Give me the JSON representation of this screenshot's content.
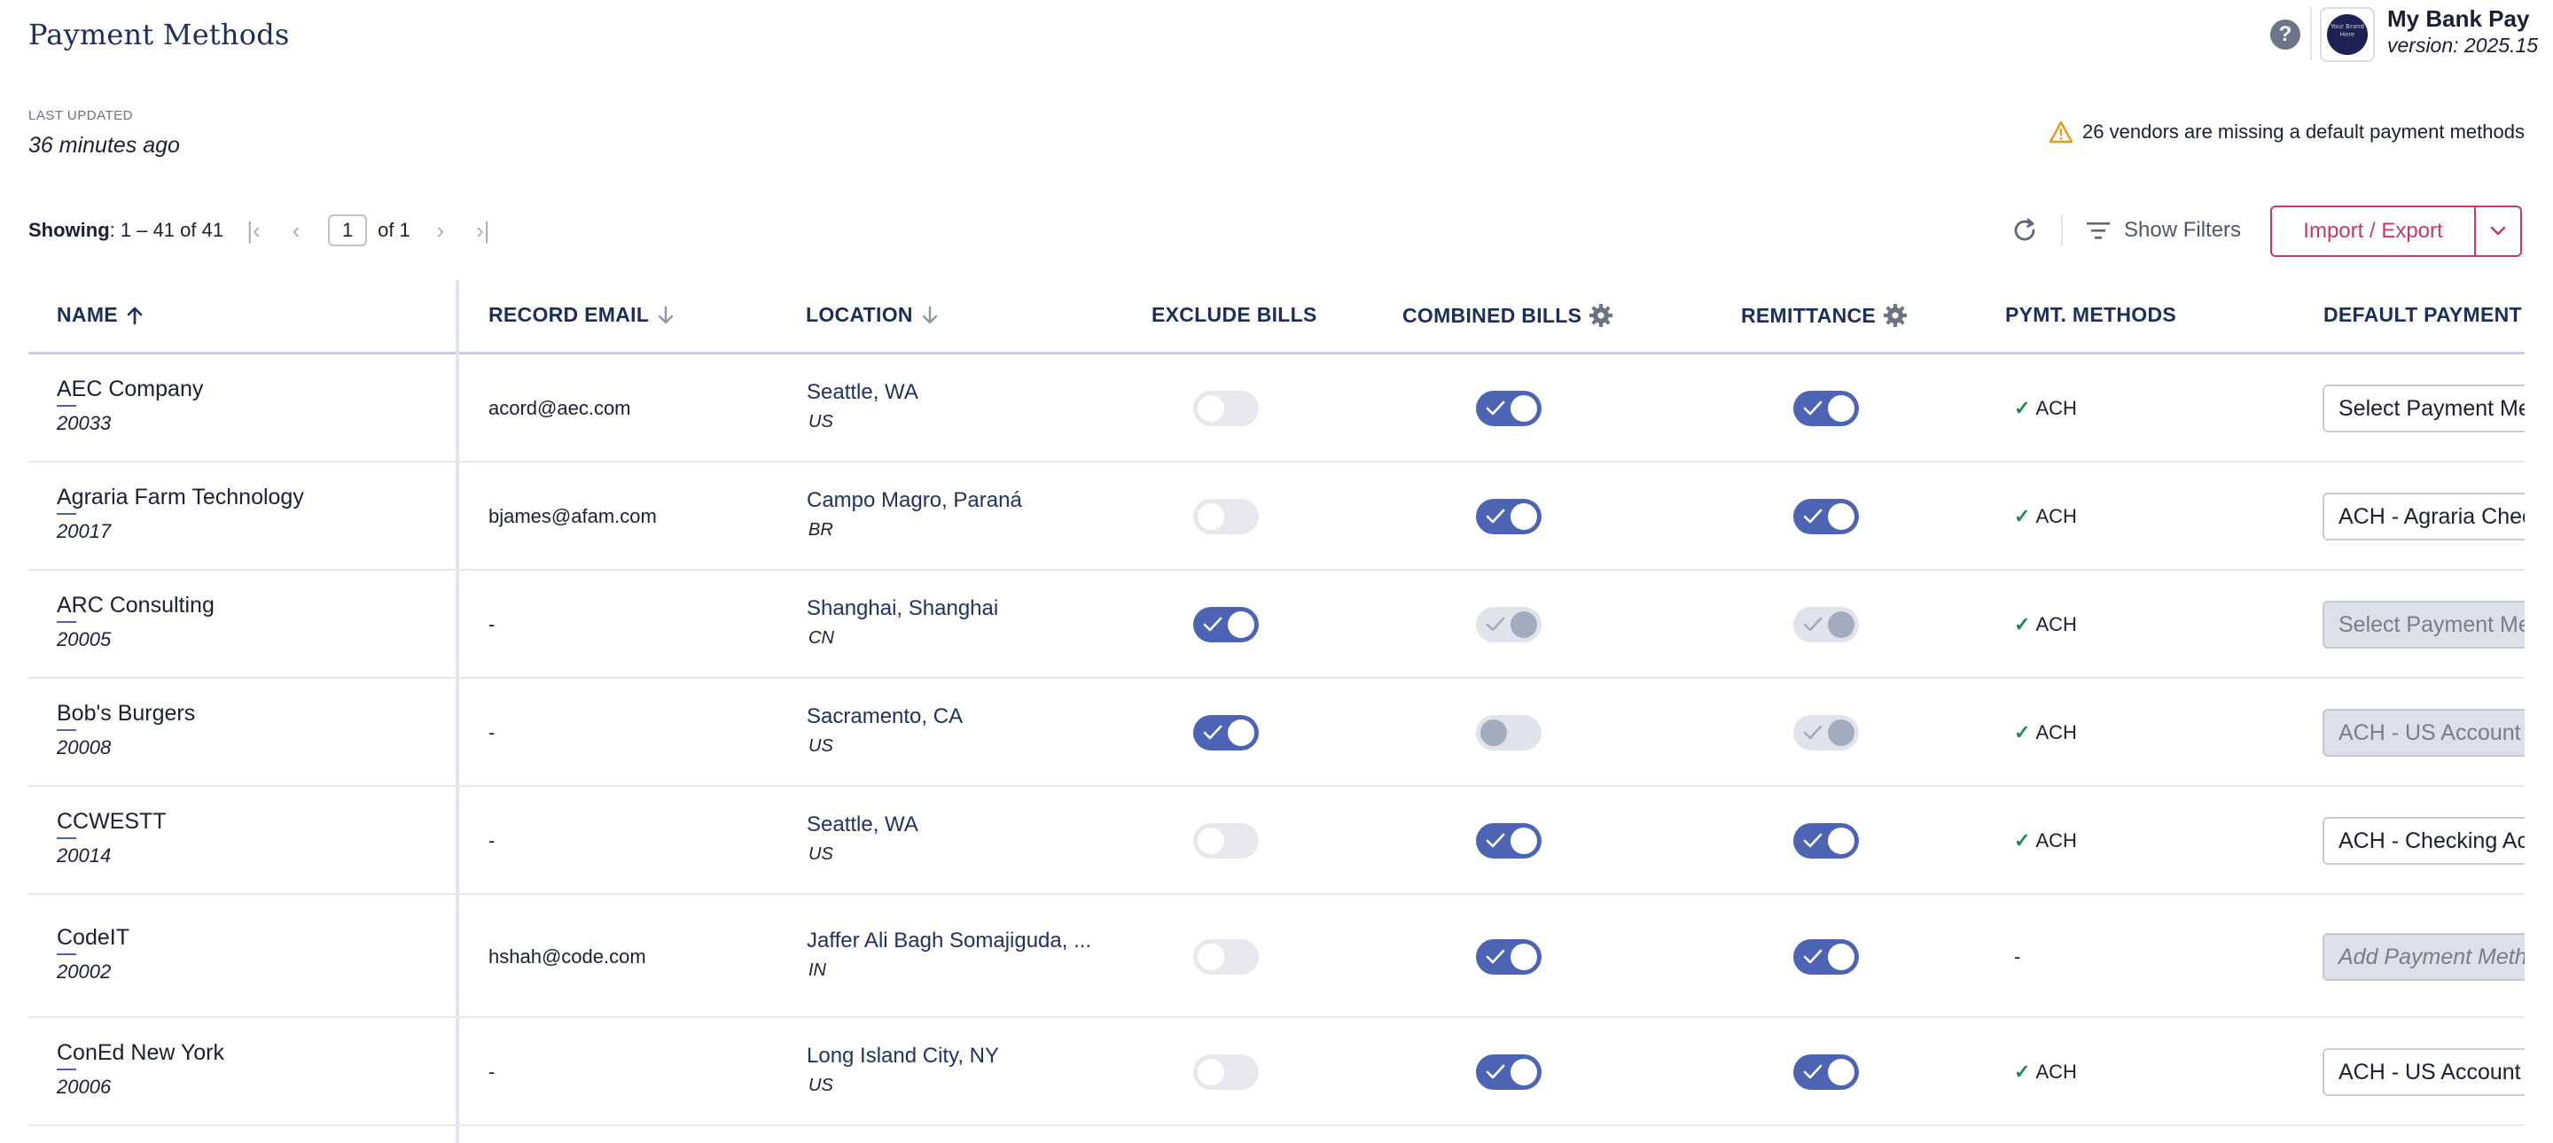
{
  "header": {
    "title": "Payment Methods",
    "app_name": "My Bank Pay",
    "app_version": "version: 2025.15",
    "logo_text": "Your Brand Here"
  },
  "status": {
    "last_updated_label": "LAST UPDATED",
    "last_updated_value": "36 minutes ago",
    "warning": "26 vendors are missing a default payment methods"
  },
  "pager": {
    "showing_label": "Showing",
    "showing_range": ": 1 – 41 of 41",
    "page": "1",
    "of_pages": "of 1"
  },
  "toolbar": {
    "show_filters": "Show Filters",
    "import_export": "Import / Export"
  },
  "columns": {
    "name": "NAME",
    "record_email": "RECORD EMAIL",
    "location": "LOCATION",
    "exclude_bills": "EXCLUDE BILLS",
    "combined_bills": "COMBINED BILLS",
    "remittance": "REMITTANCE",
    "pymt_methods": "PYMT. METHODS",
    "default_payment": "DEFAULT PAYMENT I"
  },
  "rows": [
    {
      "name": "AEC Company",
      "id": "20033",
      "email": "acord@aec.com",
      "city": "Seattle, WA",
      "country": "US",
      "exclude": "off",
      "combined": "on",
      "remittance": "on",
      "pm": "ACH",
      "pm_check": true,
      "default": "Select Payment Me",
      "default_state": "normal"
    },
    {
      "name": "Agraria Farm Technology",
      "id": "20017",
      "email": "bjames@afam.com",
      "city": "Campo Magro, Paraná",
      "country": "BR",
      "exclude": "off",
      "combined": "on",
      "remittance": "on",
      "pm": "ACH",
      "pm_check": true,
      "default": "ACH - Agraria Chec",
      "default_state": "normal"
    },
    {
      "name": "ARC Consulting",
      "id": "20005",
      "email": "-",
      "city": "Shanghai, Shanghai",
      "country": "CN",
      "exclude": "on",
      "combined": "dis-on",
      "remittance": "dis-on",
      "pm": "ACH",
      "pm_check": true,
      "default": "Select Payment Me",
      "default_state": "disabled"
    },
    {
      "name": "Bob's Burgers",
      "id": "20008",
      "email": "-",
      "city": "Sacramento, CA",
      "country": "US",
      "exclude": "on",
      "combined": "dis-off",
      "remittance": "dis-on",
      "pm": "ACH",
      "pm_check": true,
      "default": "ACH - US Account (",
      "default_state": "disabled"
    },
    {
      "name": "CCWESTT",
      "id": "20014",
      "email": "-",
      "city": "Seattle, WA",
      "country": "US",
      "exclude": "off",
      "combined": "on",
      "remittance": "on",
      "pm": "ACH",
      "pm_check": true,
      "default": "ACH - Checking Acc",
      "default_state": "normal"
    },
    {
      "name": "CodeIT",
      "id": "20002",
      "email": "hshah@code.com",
      "city": "Jaffer Ali Bagh Somajiguda, ...",
      "country": "IN",
      "exclude": "off",
      "combined": "on",
      "remittance": "on",
      "pm": "-",
      "pm_check": false,
      "default": "Add Payment Meth",
      "default_state": "italic"
    },
    {
      "name": "ConEd New York",
      "id": "20006",
      "email": "-",
      "city": "Long Island City, NY",
      "country": "US",
      "exclude": "off",
      "combined": "on",
      "remittance": "on",
      "pm": "ACH",
      "pm_check": true,
      "default": "ACH - US Account (",
      "default_state": "normal"
    }
  ]
}
